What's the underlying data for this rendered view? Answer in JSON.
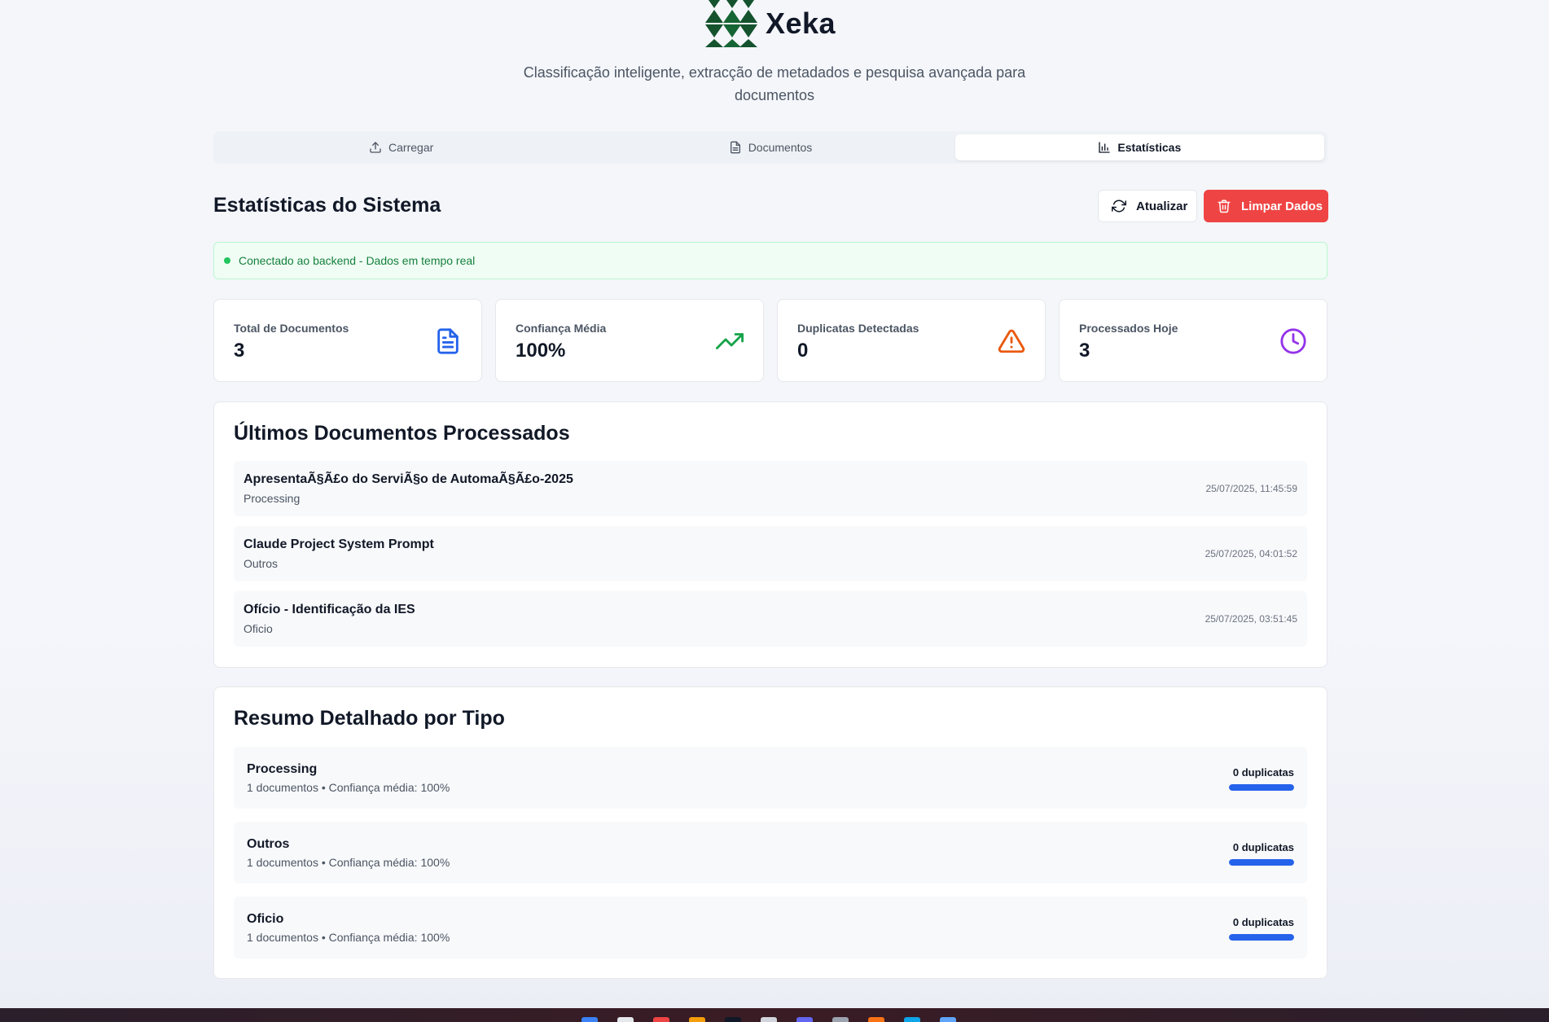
{
  "app": {
    "name": "Xeka",
    "subtitle": "Classificação inteligente, extracção de metadados e pesquisa avançada para documentos"
  },
  "tabs": [
    {
      "label": "Carregar",
      "icon": "upload-icon",
      "active": false
    },
    {
      "label": "Documentos",
      "icon": "document-icon",
      "active": false
    },
    {
      "label": "Estatísticas",
      "icon": "bar-chart-icon",
      "active": true
    }
  ],
  "section": {
    "title": "Estatísticas do Sistema",
    "refresh_label": "Atualizar",
    "clear_label": "Limpar Dados"
  },
  "status": {
    "text": "Conectado ao backend - Dados em tempo real",
    "color": "#22c55e"
  },
  "stats": [
    {
      "label": "Total de Documentos",
      "value": "3",
      "icon": "file-text-icon",
      "color": "#2563eb"
    },
    {
      "label": "Confiança Média",
      "value": "100%",
      "icon": "trending-up-icon",
      "color": "#16a34a"
    },
    {
      "label": "Duplicatas Detectadas",
      "value": "0",
      "icon": "alert-triangle-icon",
      "color": "#ea580c"
    },
    {
      "label": "Processados Hoje",
      "value": "3",
      "icon": "clock-icon",
      "color": "#9333ea"
    }
  ],
  "recent": {
    "title": "Últimos Documentos Processados",
    "items": [
      {
        "name": "ApresentaÃ§Ã£o do ServiÃ§o de AutomaÃ§Ã£o-2025",
        "type": "Processing",
        "date": "25/07/2025, 11:45:59"
      },
      {
        "name": "Claude Project System Prompt",
        "type": "Outros",
        "date": "25/07/2025, 04:01:52"
      },
      {
        "name": "Ofício - Identificação da IES",
        "type": "Oficio",
        "date": "25/07/2025, 03:51:45"
      }
    ]
  },
  "summary": {
    "title": "Resumo Detalhado por Tipo",
    "items": [
      {
        "name": "Processing",
        "meta": "1 documentos • Confiança média: 100%",
        "duplicates": "0 duplicatas",
        "confidence": 1.0
      },
      {
        "name": "Outros",
        "meta": "1 documentos • Confiança média: 100%",
        "duplicates": "0 duplicatas",
        "confidence": 1.0
      },
      {
        "name": "Oficio",
        "meta": "1 documentos • Confiança média: 100%",
        "duplicates": "0 duplicatas",
        "confidence": 1.0
      }
    ]
  },
  "colors": {
    "accent": "#2563eb",
    "danger": "#ef4444",
    "brand": "#14532d"
  }
}
